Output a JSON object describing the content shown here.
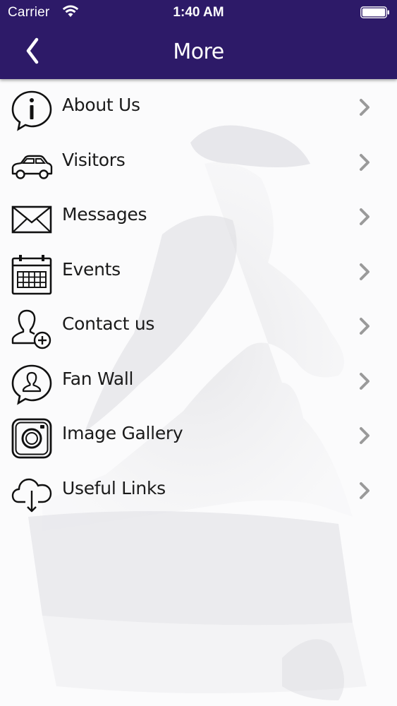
{
  "status_bar": {
    "carrier": "Carrier",
    "time": "1:40 AM"
  },
  "nav": {
    "title": "More",
    "back_icon": "chevron-left-icon"
  },
  "colors": {
    "header_bg": "#2d1a68",
    "text": "#1a1a1a",
    "chevron": "#9a9a9a"
  },
  "menu": {
    "items": [
      {
        "label": "About Us",
        "icon": "info-bubble-icon"
      },
      {
        "label": "Visitors",
        "icon": "car-icon"
      },
      {
        "label": "Messages",
        "icon": "envelope-icon"
      },
      {
        "label": "Events",
        "icon": "calendar-icon"
      },
      {
        "label": "Contact us",
        "icon": "add-contact-icon"
      },
      {
        "label": "Fan Wall",
        "icon": "person-bubble-icon"
      },
      {
        "label": "Image Gallery",
        "icon": "camera-icon"
      },
      {
        "label": "Useful Links",
        "icon": "cloud-download-icon"
      }
    ]
  }
}
